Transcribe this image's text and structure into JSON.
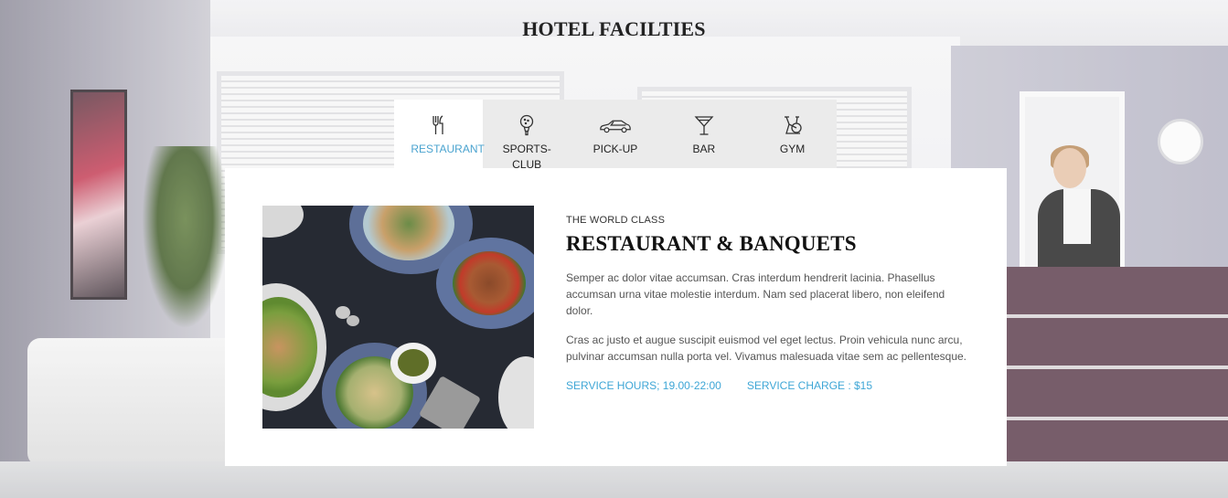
{
  "section_title": "HOTEL FACILTIES",
  "tabs": [
    {
      "label": "RESTAURANT",
      "icon": "cutlery-icon",
      "active": true
    },
    {
      "label": "SPORTS-CLUB",
      "icon": "golf-ball-icon",
      "active": false
    },
    {
      "label": "PICK-UP",
      "icon": "car-icon",
      "active": false
    },
    {
      "label": "BAR",
      "icon": "cocktail-glass-icon",
      "active": false
    },
    {
      "label": "GYM",
      "icon": "exercise-bike-icon",
      "active": false
    }
  ],
  "card": {
    "eyebrow": "THE WORLD CLASS",
    "title": "RESTAURANT & BANQUETS",
    "paragraph_1": "Semper ac dolor vitae accumsan. Cras interdum hendrerit lacinia. Phasellus accumsan urna vitae molestie interdum. Nam sed placerat libero, non eleifend dolor.",
    "paragraph_2": "Cras ac justo et augue suscipit euismod vel eget lectus. Proin vehicula nunc arcu, pulvinar accumsan nulla porta vel. Vivamus malesuada vitae sem ac pellentesque.",
    "service_hours": "SERVICE HOURS; 19.00-22:00",
    "service_charge": "SERVICE CHARGE : $15"
  },
  "colors": {
    "accent": "#4aa3cf",
    "tab_bar_bg": "#ebebeb",
    "card_bg": "#ffffff"
  }
}
